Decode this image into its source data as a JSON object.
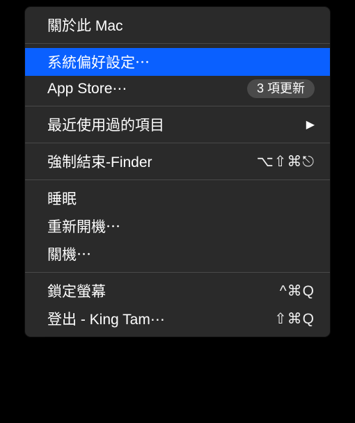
{
  "menu": {
    "about": {
      "label": "關於此 Mac"
    },
    "prefs": {
      "label": "系統偏好設定⋯"
    },
    "appstore": {
      "label": "App Store⋯",
      "badge": "3 項更新"
    },
    "recent": {
      "label": "最近使用過的項目"
    },
    "forcequit": {
      "label": "強制結束-Finder",
      "shortcut": "⌥⇧⌘⎋"
    },
    "sleep": {
      "label": "睡眠"
    },
    "restart": {
      "label": "重新開機⋯"
    },
    "shutdown": {
      "label": "關機⋯"
    },
    "lock": {
      "label": "鎖定螢幕",
      "shortcut": "^⌘Q"
    },
    "logout": {
      "label": "登出 - King Tam⋯",
      "shortcut": "⇧⌘Q"
    }
  }
}
